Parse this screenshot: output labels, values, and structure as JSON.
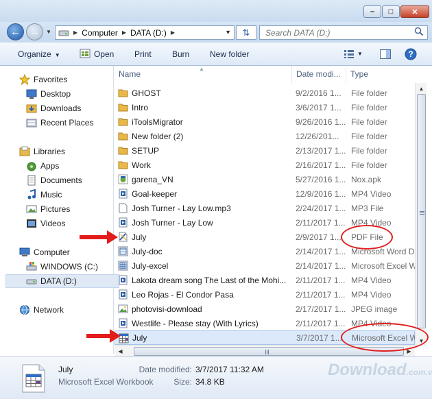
{
  "window": {
    "controls": [
      "minimize",
      "maximize",
      "close"
    ]
  },
  "navigation": {
    "path": [
      "Computer",
      "DATA (D:)"
    ],
    "search_placeholder": "Search DATA (D:)"
  },
  "toolbar": {
    "organize": "Organize",
    "open": "Open",
    "print": "Print",
    "burn": "Burn",
    "new_folder": "New folder"
  },
  "sidebar": {
    "favorites": {
      "label": "Favorites",
      "items": [
        "Desktop",
        "Downloads",
        "Recent Places"
      ]
    },
    "libraries": {
      "label": "Libraries",
      "items": [
        "Apps",
        "Documents",
        "Music",
        "Pictures",
        "Videos"
      ]
    },
    "computer": {
      "label": "Computer",
      "items": [
        "WINDOWS (C:)",
        "DATA (D:)"
      ]
    },
    "network": {
      "label": "Network"
    }
  },
  "columns": {
    "name": "Name",
    "date": "Date modi...",
    "type": "Type"
  },
  "files": [
    {
      "name": "GHOST",
      "date": "9/2/2016 1...",
      "type": "File folder",
      "icon": "folder-icon"
    },
    {
      "name": "Intro",
      "date": "3/6/2017 1...",
      "type": "File folder",
      "icon": "folder-icon"
    },
    {
      "name": "iToolsMigrator",
      "date": "9/26/2016 1...",
      "type": "File folder",
      "icon": "folder-icon"
    },
    {
      "name": "New folder (2)",
      "date": "12/26/201...",
      "type": "File folder",
      "icon": "folder-icon"
    },
    {
      "name": "SETUP",
      "date": "2/13/2017 1...",
      "type": "File folder",
      "icon": "folder-icon"
    },
    {
      "name": "Work",
      "date": "2/16/2017 1...",
      "type": "File folder",
      "icon": "folder-icon"
    },
    {
      "name": "garena_VN",
      "date": "5/27/2016 1...",
      "type": "Nox.apk",
      "icon": "apk-icon"
    },
    {
      "name": "Goal-keeper",
      "date": "12/9/2016 1...",
      "type": "MP4 Video",
      "icon": "video-icon"
    },
    {
      "name": "Josh Turner - Lay Low.mp3",
      "date": "2/24/2017 1...",
      "type": "MP3 File",
      "icon": "file-icon"
    },
    {
      "name": "Josh Turner - Lay Low",
      "date": "2/11/2017 1...",
      "type": "MP4 Video",
      "icon": "video-icon"
    },
    {
      "name": "July",
      "date": "2/9/2017 1...",
      "type": "PDF File",
      "icon": "pdf-icon"
    },
    {
      "name": "July-doc",
      "date": "2/14/2017 1...",
      "type": "Microsoft Word D",
      "icon": "word-doc-icon"
    },
    {
      "name": "July-excel",
      "date": "2/14/2017 1...",
      "type": "Microsoft Excel W",
      "icon": "excel-doc-icon"
    },
    {
      "name": "Lakota dream song The Last of the Mohi...",
      "date": "2/11/2017 1...",
      "type": "MP4 Video",
      "icon": "video-icon"
    },
    {
      "name": "Leo Rojas - El Condor Pasa",
      "date": "2/11/2017 1...",
      "type": "MP4 Video",
      "icon": "video-icon"
    },
    {
      "name": "photovisi-download",
      "date": "2/17/2017 1...",
      "type": "JPEG image",
      "icon": "image-icon"
    },
    {
      "name": "Westlife - Please stay (With Lyrics)",
      "date": "2/11/2017 1...",
      "type": "MP4 Video",
      "icon": "video-icon"
    },
    {
      "name": "July",
      "date": "3/7/2017 1...",
      "type": "Microsoft Excel W",
      "icon": "excel-icon",
      "selected": true
    }
  ],
  "details": {
    "name": "July",
    "type": "Microsoft Excel Workbook",
    "date_label": "Date modified:",
    "date_value": "3/7/2017 11:32 AM",
    "size_label": "Size:",
    "size_value": "34.8 KB"
  },
  "watermark": {
    "main": "Download",
    "suffix": ".com.vn"
  },
  "colors": {
    "annotation_red": "#e02020",
    "selection": "#dbe9fb",
    "folder": "#e8b94a"
  }
}
